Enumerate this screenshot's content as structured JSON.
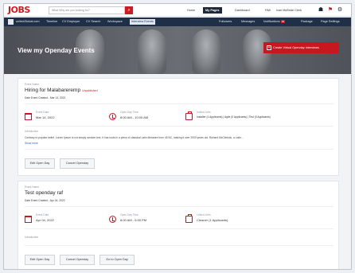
{
  "header": {
    "logo": "JOBS",
    "logo_sub": "UnitedGlobal",
    "search_placeholder": "What Why are you looking for?",
    "links": [
      "Home",
      "My Pages",
      "Dashboard",
      "RMI",
      "Ivan McBride Clerk"
    ],
    "icons": [
      "people-icon",
      "flag-icon",
      "settings-icon"
    ]
  },
  "nav": {
    "items": [
      "unitedGlobal.com",
      "Timeline",
      "CV Employer",
      "CV Search",
      "Workspace",
      "Interview Events",
      "Followers",
      "Messages",
      "Notifications",
      "Package",
      "Page Settings"
    ],
    "notif_badge": "30",
    "active": "Interview Events"
  },
  "hero": {
    "title": "View my Openday Events",
    "create_label": "Create Virtual Openday Interviews"
  },
  "events": [
    {
      "name_label": "Event Name",
      "name": "Hiring for Malabareremp",
      "status": "Unpublished",
      "created": "Date Event Created - Mar 14, 2022",
      "date_label": "Event Date",
      "date": "Mar 14, 2022",
      "time_label": "Open Day Time",
      "time": "8:00 AM - 10:00 AM",
      "jobs_label": "Invited Jobs",
      "jobs": "Installer (1 Applicants)  |  Agile (0 Applicants)  |  Test (0 Applicants)",
      "desc_label": "Introduction",
      "desc": "Contrary to popular belief, Lorem Ipsum is not simply random text. It has roots in a piece of classical Latin literature from 45 BC, making it over 2000 years old. Richard McClintock, a Latin...",
      "more": "Show more",
      "buttons": [
        "Edit Open Day",
        "Cancel Openday"
      ]
    },
    {
      "name_label": "Event Name",
      "name": "Test openday raf",
      "created": "Date Event Created - Apr 04, 2022",
      "date_label": "Event Date",
      "date": "Apr 04, 2022",
      "time_label": "Open Day Time",
      "time": "8:00 AM - 6:00 PM",
      "jobs_label": "Linked Jobs",
      "jobs": "Cleaner (1 Applicants)",
      "desc_label": "Introduction",
      "buttons": [
        "Edit Open Day",
        "Cancel Openday",
        "Go to Open Day"
      ]
    }
  ],
  "colors": {
    "brand_red": "#c8171f",
    "nav_dark": "#1e2f47"
  }
}
